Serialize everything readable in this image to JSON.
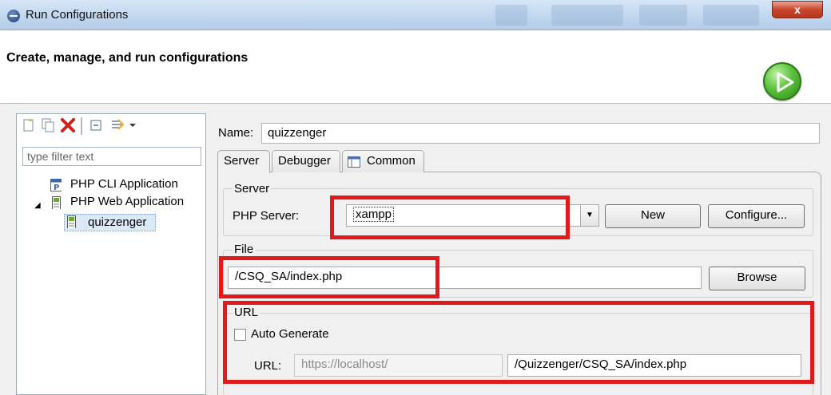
{
  "window": {
    "title": "Run Configurations",
    "close_symbol": "x"
  },
  "header": {
    "title": "Create, manage, and run configurations"
  },
  "sidebar": {
    "filter_placeholder": "type filter text",
    "tree": [
      {
        "label": "PHP CLI Application",
        "icon": "php-cli-icon"
      },
      {
        "label": "PHP Web Application",
        "icon": "php-web-icon",
        "expanded": true
      },
      {
        "label": "quizzenger",
        "icon": "php-file-icon",
        "selected": true
      }
    ]
  },
  "form": {
    "name_label": "Name:",
    "name_value": "quizzenger",
    "tabs": [
      {
        "label": "Server",
        "active": true
      },
      {
        "label": "Debugger",
        "active": false
      },
      {
        "label": "Common",
        "active": false
      }
    ],
    "server_group": {
      "title": "Server",
      "php_server_label": "PHP Server:",
      "php_server_value": "xampp",
      "new_button": "New",
      "configure_button": "Configure..."
    },
    "file_group": {
      "title": "File",
      "file_value": "/CSQ_SA/index.php",
      "browse_button": "Browse"
    },
    "url_group": {
      "title": "URL",
      "auto_generate_label": "Auto Generate",
      "auto_generate_checked": false,
      "url_label": "URL:",
      "url_base": "https://localhost/",
      "url_path": "/Quizzenger/CSQ_SA/index.php"
    }
  },
  "colors": {
    "highlight": "#e01a1a",
    "selection": "#dbe8f8"
  }
}
